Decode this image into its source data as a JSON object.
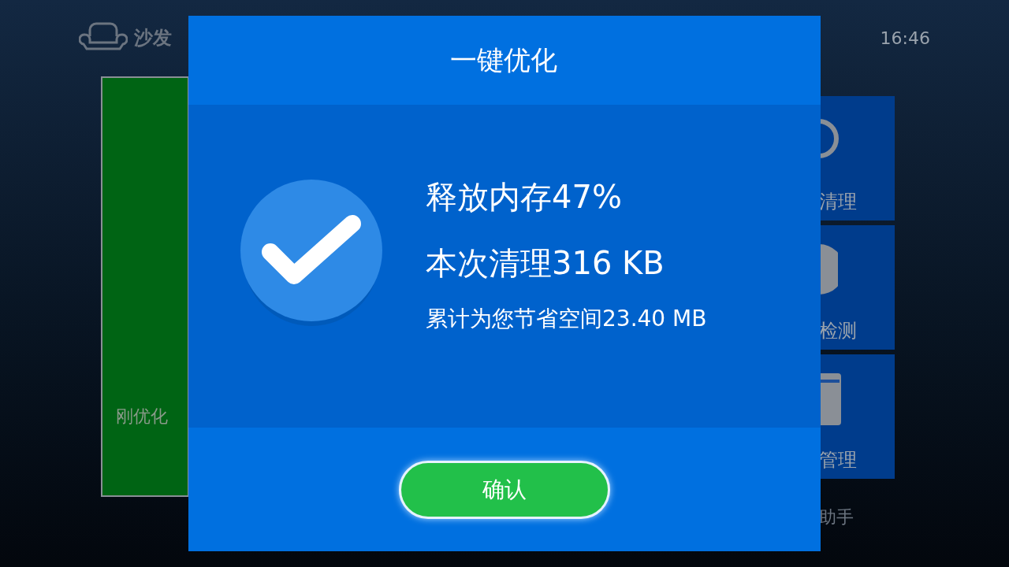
{
  "header": {
    "brand": "沙发",
    "time": "16:46"
  },
  "left_tile": {
    "label": "刚优化"
  },
  "right_tiles": [
    {
      "kind": "ring",
      "label": "清理"
    },
    {
      "kind": "disc",
      "label": "检测"
    },
    {
      "kind": "box",
      "label": "管理"
    }
  ],
  "footer_label": "助手",
  "dialog": {
    "title": "一键优化",
    "lines": [
      {
        "kind": "large",
        "text": "释放内存47%"
      },
      {
        "kind": "large",
        "text": "本次清理316 KB"
      },
      {
        "kind": "small",
        "text": "累计为您节省空间23.40 MB"
      }
    ],
    "confirm_button": "确认"
  }
}
